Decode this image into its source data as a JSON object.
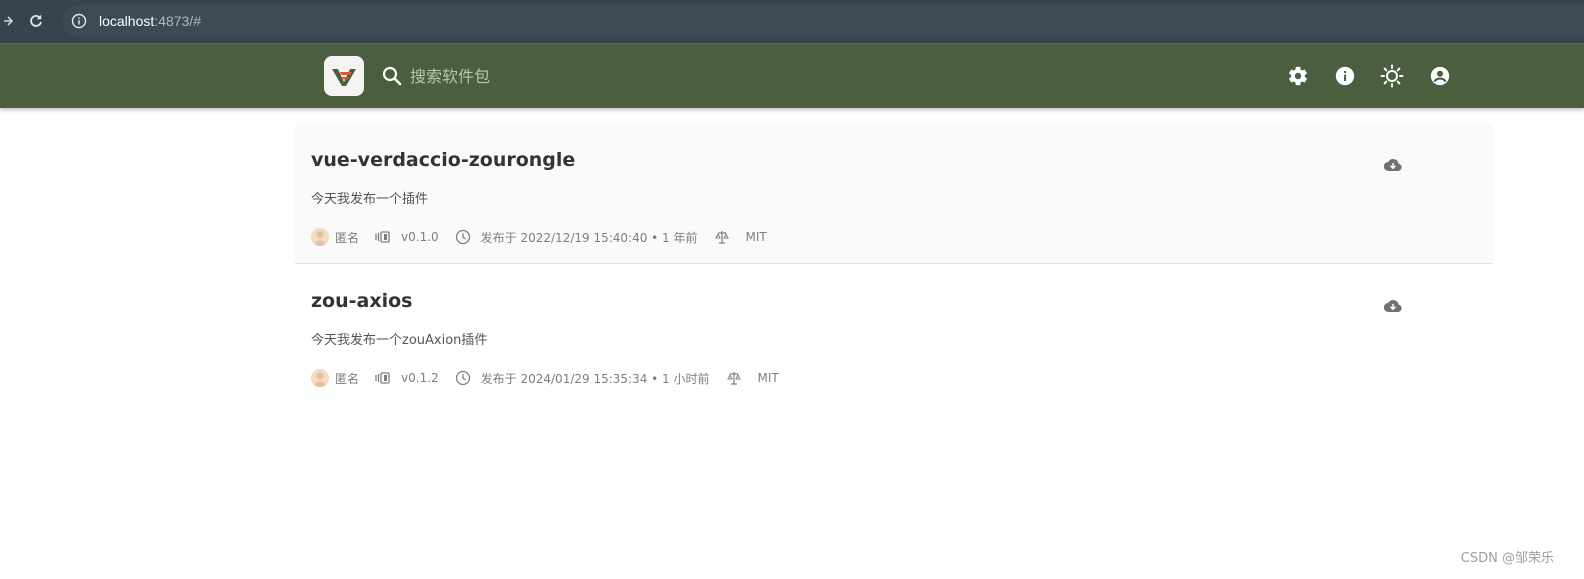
{
  "browser": {
    "url_host": "localhost",
    "url_rest": ":4873/#"
  },
  "header": {
    "logo_letter": "V",
    "search_placeholder": "搜索软件包",
    "icons": [
      "settings-icon",
      "info-icon",
      "brightness-icon",
      "account-icon"
    ],
    "colors": {
      "header_bg": "#4b5e3f",
      "logo_green": "#4b5e3f",
      "logo_accent": "#e8542a"
    }
  },
  "packages": [
    {
      "name": "vue-verdaccio-zourongle",
      "description": "今天我发布一个插件",
      "author": "匿名",
      "version": "v0.1.0",
      "published": "发布于 2022/12/19 15:40:40 • 1 年前",
      "license": "MIT"
    },
    {
      "name": "zou-axios",
      "description": "今天我发布一个zouAxion插件",
      "author": "匿名",
      "version": "v0.1.2",
      "published": "发布于 2024/01/29 15:35:34 • 1 小时前",
      "license": "MIT"
    }
  ],
  "watermark": "CSDN @邹荣乐"
}
